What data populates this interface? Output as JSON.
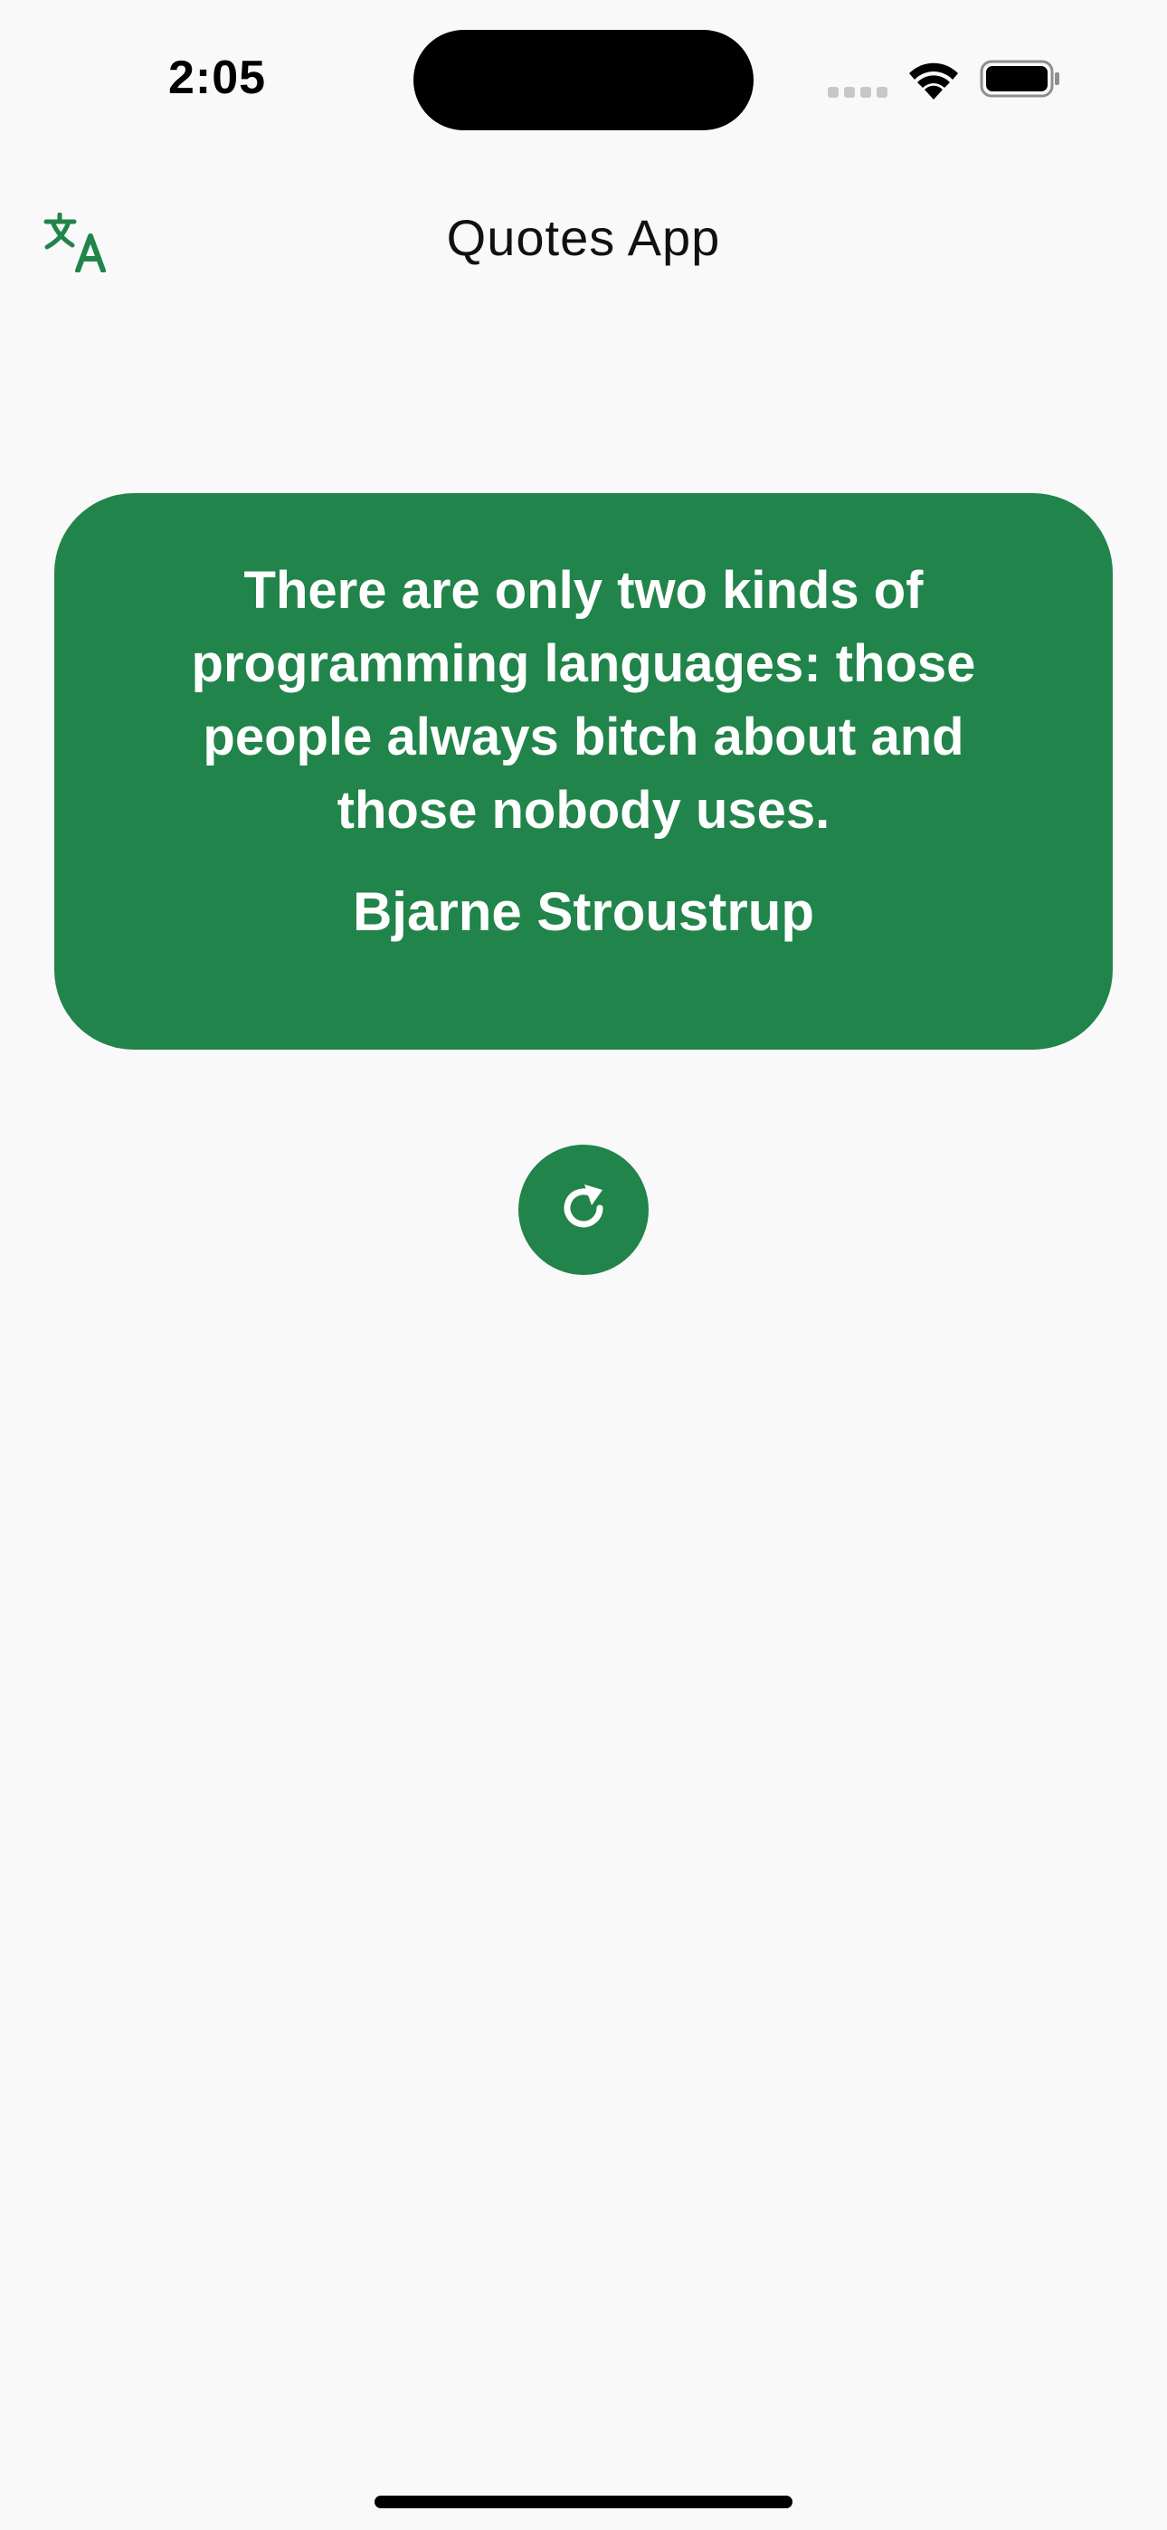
{
  "status_bar": {
    "time": "2:05",
    "signal_icon": "cellular-signal-icon",
    "wifi_icon": "wifi-icon",
    "battery_icon": "battery-icon"
  },
  "app_bar": {
    "title": "Quotes App",
    "translate_icon": "translate-icon"
  },
  "quote": {
    "text": "There are only two kinds of programming languages: those people always bitch about and those nobody uses.",
    "author": "Bjarne Stroustrup"
  },
  "actions": {
    "refresh_icon": "refresh-icon"
  },
  "colors": {
    "accent": "#21844a",
    "background": "#f9f9f9",
    "text_on_accent": "#ffffff"
  }
}
